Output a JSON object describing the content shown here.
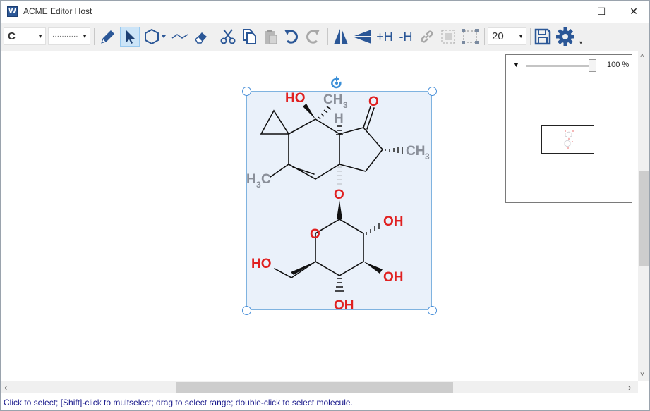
{
  "window": {
    "title": "ACME Editor Host",
    "app_icon_letter": "W",
    "minimize_glyph": "—",
    "maximize_glyph": "☐",
    "close_glyph": "✕"
  },
  "toolbar": {
    "element_value": "C",
    "bond_style_value": "···········",
    "add_h_label": "+H",
    "remove_h_label": "-H",
    "font_size_value": "20"
  },
  "molecule": {
    "labels": {
      "ho_top": "HO",
      "ch3_top": "CH",
      "ch3_top_sub": "3",
      "h_bridge": "H",
      "o_ketone": "O",
      "ch3_right": "CH",
      "ch3_right_sub": "3",
      "h3c_left": "H",
      "h3c_left_sub": "3",
      "h3c_left_c": "C",
      "o_link": "O",
      "o_ring": "O",
      "oh_1": "OH",
      "oh_2": "OH",
      "oh_3": "OH",
      "ho_ch2": "HO"
    },
    "colors": {
      "hetero": "#e02020",
      "carbon_label": "#8a8f99",
      "bond": "#111111"
    }
  },
  "navigator": {
    "dropdown_glyph": "▼",
    "zoom": "100 %"
  },
  "scrollbar": {
    "left": "‹",
    "right": "›",
    "up": "˄",
    "down": "˅"
  },
  "status": {
    "text": "Click to select; [Shift]-click to multselect; drag to select range; double-click to select molecule."
  }
}
